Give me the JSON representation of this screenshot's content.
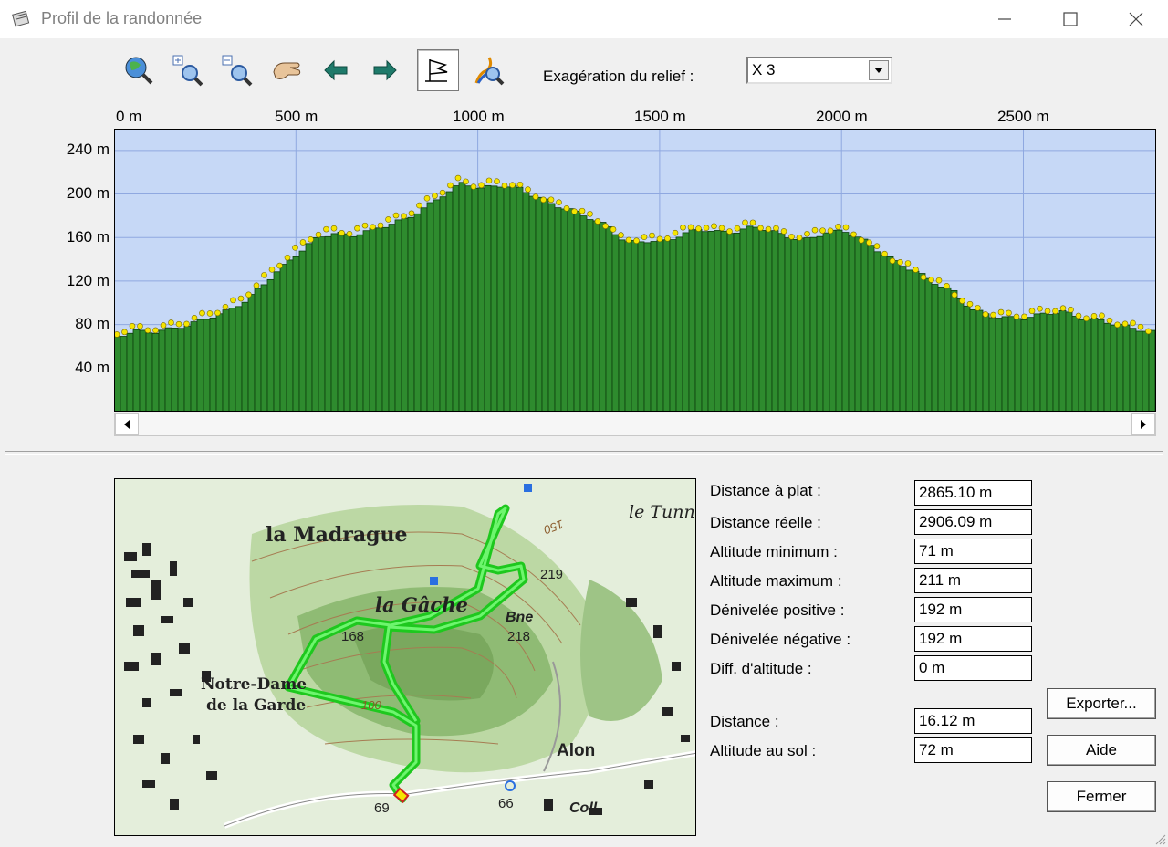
{
  "window": {
    "title": "Profil de la randonnée"
  },
  "toolbar": {
    "tools": [
      {
        "name": "globe-zoom-icon"
      },
      {
        "name": "zoom-in-icon"
      },
      {
        "name": "zoom-out-icon"
      },
      {
        "name": "pan-hand-icon"
      },
      {
        "name": "arrow-left-icon"
      },
      {
        "name": "arrow-right-icon"
      },
      {
        "name": "flag-icon",
        "active": true
      },
      {
        "name": "path-zoom-icon"
      }
    ],
    "relief_label": "Exagération du relief :",
    "relief_value": "X 3"
  },
  "chart_data": {
    "type": "area",
    "x_ticks": [
      "0 m",
      "500 m",
      "1000 m",
      "1500 m",
      "2000 m",
      "2500 m"
    ],
    "y_ticks": [
      "240 m",
      "200 m",
      "160 m",
      "120 m",
      "80 m",
      "40 m"
    ],
    "xlim": [
      0,
      2865
    ],
    "ylim": [
      0,
      260
    ],
    "grid": true,
    "colors": {
      "background": "#c6d8f6",
      "grid": "#8fa8e0",
      "fill": "#2e8b2e",
      "marker": "#f5e400"
    },
    "profile": {
      "x": [
        0,
        50,
        100,
        150,
        200,
        250,
        300,
        350,
        400,
        450,
        500,
        550,
        600,
        650,
        700,
        750,
        800,
        850,
        900,
        950,
        1000,
        1050,
        1100,
        1150,
        1200,
        1250,
        1300,
        1350,
        1400,
        1450,
        1500,
        1550,
        1600,
        1650,
        1700,
        1750,
        1800,
        1850,
        1900,
        1950,
        2000,
        2050,
        2100,
        2150,
        2200,
        2250,
        2300,
        2350,
        2400,
        2450,
        2500,
        2550,
        2600,
        2650,
        2700,
        2750,
        2800,
        2865
      ],
      "y": [
        69,
        74,
        73,
        76,
        80,
        86,
        92,
        101,
        116,
        132,
        146,
        160,
        164,
        162,
        167,
        172,
        178,
        188,
        200,
        210,
        205,
        208,
        206,
        198,
        190,
        185,
        178,
        170,
        155,
        157,
        156,
        162,
        168,
        165,
        165,
        170,
        166,
        160,
        158,
        165,
        166,
        158,
        146,
        136,
        128,
        118,
        110,
        94,
        88,
        86,
        86,
        90,
        92,
        86,
        84,
        80,
        76,
        72
      ]
    }
  },
  "stats": [
    {
      "label": "Distance à plat :",
      "value": "2865.10 m"
    },
    {
      "label": "Distance réelle :",
      "value": "2906.09 m"
    },
    {
      "label": "Altitude minimum :",
      "value": "71 m"
    },
    {
      "label": "Altitude maximum :",
      "value": "211 m"
    },
    {
      "label": "Dénivelée positive :",
      "value": "192 m"
    },
    {
      "label": "Dénivelée négative :",
      "value": "192 m"
    },
    {
      "label": "Diff. d'altitude :",
      "value": "0 m"
    }
  ],
  "cursor": [
    {
      "label": "Distance :",
      "value": "16.12 m"
    },
    {
      "label": "Altitude au sol :",
      "value": "72 m"
    }
  ],
  "buttons": {
    "export": "Exporter...",
    "help": "Aide",
    "close": "Fermer"
  },
  "map": {
    "labels": {
      "madrague": "la Madrague",
      "gache": "la Gâche",
      "notredame1": "Notre-Dame",
      "notredame2": "de la Garde",
      "alon": "Alon",
      "coll": "Coll.",
      "tunnel": "le Tunn",
      "bne": "Bne",
      "h219": "219",
      "h218": "218",
      "h168": "168",
      "h150": "150",
      "h100": "100",
      "h69": "69",
      "h66": "66"
    },
    "colors": {
      "track": "#22dd22",
      "terrain": "#cfe3bc",
      "relief": "#7fae6a"
    }
  }
}
